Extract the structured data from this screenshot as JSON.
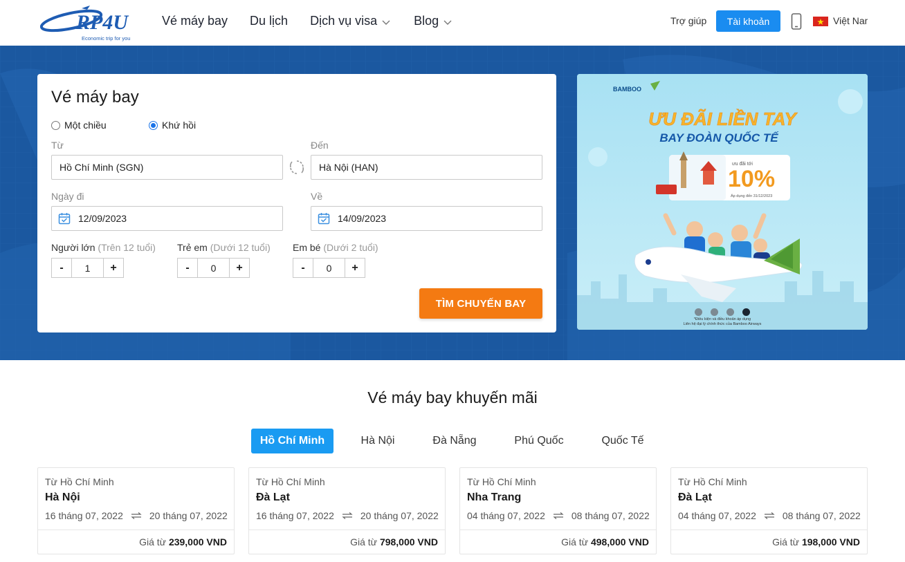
{
  "header": {
    "logo_text": "RP4U",
    "logo_tagline": "Economic trip for you",
    "nav": [
      {
        "label": "Vé máy bay",
        "has_dropdown": false
      },
      {
        "label": "Du lịch",
        "has_dropdown": false
      },
      {
        "label": "Dịch vụ visa",
        "has_dropdown": true
      },
      {
        "label": "Blog",
        "has_dropdown": true
      }
    ],
    "help": "Trợ giúp",
    "account": "Tài khoản",
    "phone_icon": "mobile-phone-icon",
    "flag_icon": "vietnam-flag-icon",
    "language": "Việt Nam"
  },
  "search": {
    "title": "Vé máy bay",
    "trip_types": [
      {
        "label": "Một chiều",
        "selected": false
      },
      {
        "label": "Khứ hồi",
        "selected": true
      }
    ],
    "from_label": "Từ",
    "from_value": "Hồ Chí Minh (SGN)",
    "to_label": "Đến",
    "to_value": "Hà Nội (HAN)",
    "depart_label": "Ngày đi",
    "depart_value": "12/09/2023",
    "return_label": "Về",
    "return_value": "14/09/2023",
    "passengers": [
      {
        "label": "Người lớn",
        "note": "(Trên 12 tuổi)",
        "value": "1"
      },
      {
        "label": "Trẻ em",
        "note": "(Dưới 12 tuổi)",
        "value": "0"
      },
      {
        "label": "Em bé",
        "note": "(Dưới 2 tuổi)",
        "value": "0"
      }
    ],
    "minus": "-",
    "plus": "+",
    "submit": "TÌM CHUYẾN BAY"
  },
  "banner": {
    "airline": "BAMBOO",
    "headline1": "ƯU ĐÃI LIỀN TAY",
    "headline2": "BAY ĐOÀN QUỐC TẾ",
    "offer_prefix": "ưu đãi tới",
    "offer_value": "10%",
    "offer_until": "Áp dụng đến 31/12/2023",
    "footnote1": "*Điều kiện và điều khoản áp dụng",
    "footnote2": "Liên hệ đại lý chính thức của Bamboo Airways",
    "slide_count": 4,
    "active_slide": 4
  },
  "promo": {
    "title": "Vé máy bay khuyến mãi",
    "tabs": [
      {
        "label": "Hồ Chí Minh",
        "active": true
      },
      {
        "label": "Hà Nội",
        "active": false
      },
      {
        "label": "Đà Nẵng",
        "active": false
      },
      {
        "label": "Phú Quốc",
        "active": false
      },
      {
        "label": "Quốc Tế",
        "active": false
      }
    ],
    "price_prefix": "Giá từ",
    "deals": [
      {
        "from": "Từ Hồ Chí Minh",
        "dest": "Hà Nội",
        "date_out": "16 tháng 07, 2022",
        "date_back": "20 tháng 07, 2022",
        "price": "239,000 VND"
      },
      {
        "from": "Từ Hồ Chí Minh",
        "dest": "Đà Lạt",
        "date_out": "16 tháng 07, 2022",
        "date_back": "20 tháng 07, 2022",
        "price": "798,000 VND"
      },
      {
        "from": "Từ Hồ Chí Minh",
        "dest": "Nha Trang",
        "date_out": "04 tháng 07, 2022",
        "date_back": "08 tháng 07, 2022",
        "price": "498,000 VND"
      },
      {
        "from": "Từ Hồ Chí Minh",
        "dest": "Đà Lạt",
        "date_out": "04 tháng 07, 2022",
        "date_back": "08 tháng 07, 2022",
        "price": "198,000 VND"
      }
    ]
  },
  "colors": {
    "primary": "#1a8cf0",
    "hero_bg": "#1b5aa3",
    "cta": "#f47a12",
    "tab_active": "#1a9bf2"
  }
}
